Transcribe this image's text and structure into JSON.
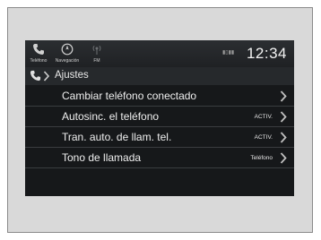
{
  "status_bar": {
    "sources": [
      {
        "label": "Teléfono",
        "icon": "phone-icon"
      },
      {
        "label": "Navegación",
        "icon": "compass-icon"
      },
      {
        "label": "FM",
        "icon": "radio-icon"
      }
    ],
    "signal_text": "▮▯▮▮",
    "clock": "12:34"
  },
  "breadcrumb": {
    "icon": "phone-icon",
    "title": "Ajustes"
  },
  "menu": {
    "items": [
      {
        "label": "Cambiar teléfono conectado",
        "value": ""
      },
      {
        "label": "Autosinc. el teléfono",
        "value": "ACTIV."
      },
      {
        "label": "Tran. auto. de llam. tel.",
        "value": "ACTIV."
      },
      {
        "label": "Tono de llamada",
        "value": "Teléfono"
      }
    ]
  },
  "colors": {
    "screen_bg": "#16181a",
    "text": "#efefef",
    "chevron": "#bfbfbf"
  }
}
